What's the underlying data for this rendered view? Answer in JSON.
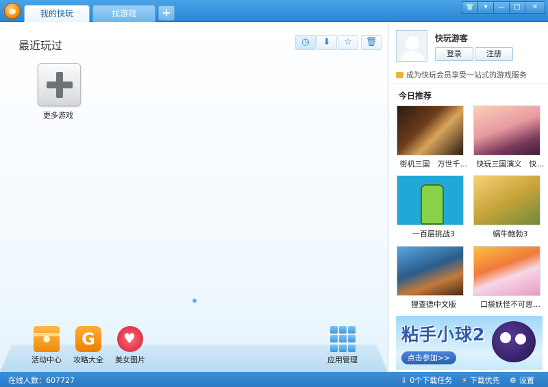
{
  "titlebar": {
    "tabs": [
      {
        "label": "我的快玩",
        "active": true
      },
      {
        "label": "找游戏",
        "active": false
      }
    ],
    "add_tab": "+",
    "window_buttons": [
      "skin-icon",
      "menu-icon",
      "minimize-icon",
      "maximize-icon",
      "close-icon"
    ],
    "window_glyphs": {
      "skin": "👕",
      "menu": "▾",
      "minimize": "—",
      "maximize": "□",
      "close": "✕"
    }
  },
  "main": {
    "section_title": "最近玩过",
    "toolbar": [
      "clock-icon",
      "download-icon",
      "star-icon",
      "trash-icon"
    ],
    "tool_glyphs": {
      "clock": "◷",
      "download": "⬇",
      "star": "☆",
      "trash": "🗑"
    },
    "more_games_label": "更多游戏",
    "dock": [
      {
        "label": "活动中心",
        "icon": "gift-icon"
      },
      {
        "label": "攻略大全",
        "icon": "guide-icon",
        "glyph": "G"
      },
      {
        "label": "美女图片",
        "icon": "heart-icon",
        "glyph": "♥"
      },
      {
        "label": "应用管理",
        "icon": "apps-icon"
      }
    ]
  },
  "sidebar": {
    "guest_name": "快玩游客",
    "login_label": "登录",
    "register_label": "注册",
    "promo_text": "成为快玩会员享受一站式的游戏服务",
    "recommend_title": "今日推荐",
    "games": [
      {
        "name": "街机三国　万世千…"
      },
      {
        "name": "快玩三国演义　快…"
      },
      {
        "name": "一百层挑战3"
      },
      {
        "name": "蜗牛鲍勃3"
      },
      {
        "name": "狸查德中文版"
      },
      {
        "name": "口袋妖怪不可思…"
      }
    ],
    "ad": {
      "title": "粘手小球2",
      "button": "点击参加>>"
    }
  },
  "status": {
    "online": "在线人数：607727",
    "downloads": "0个下载任务",
    "priority": "下载优先",
    "settings": "设置",
    "glyphs": {
      "downloads": "⇩",
      "priority": "⚡",
      "settings": "⚙"
    }
  }
}
